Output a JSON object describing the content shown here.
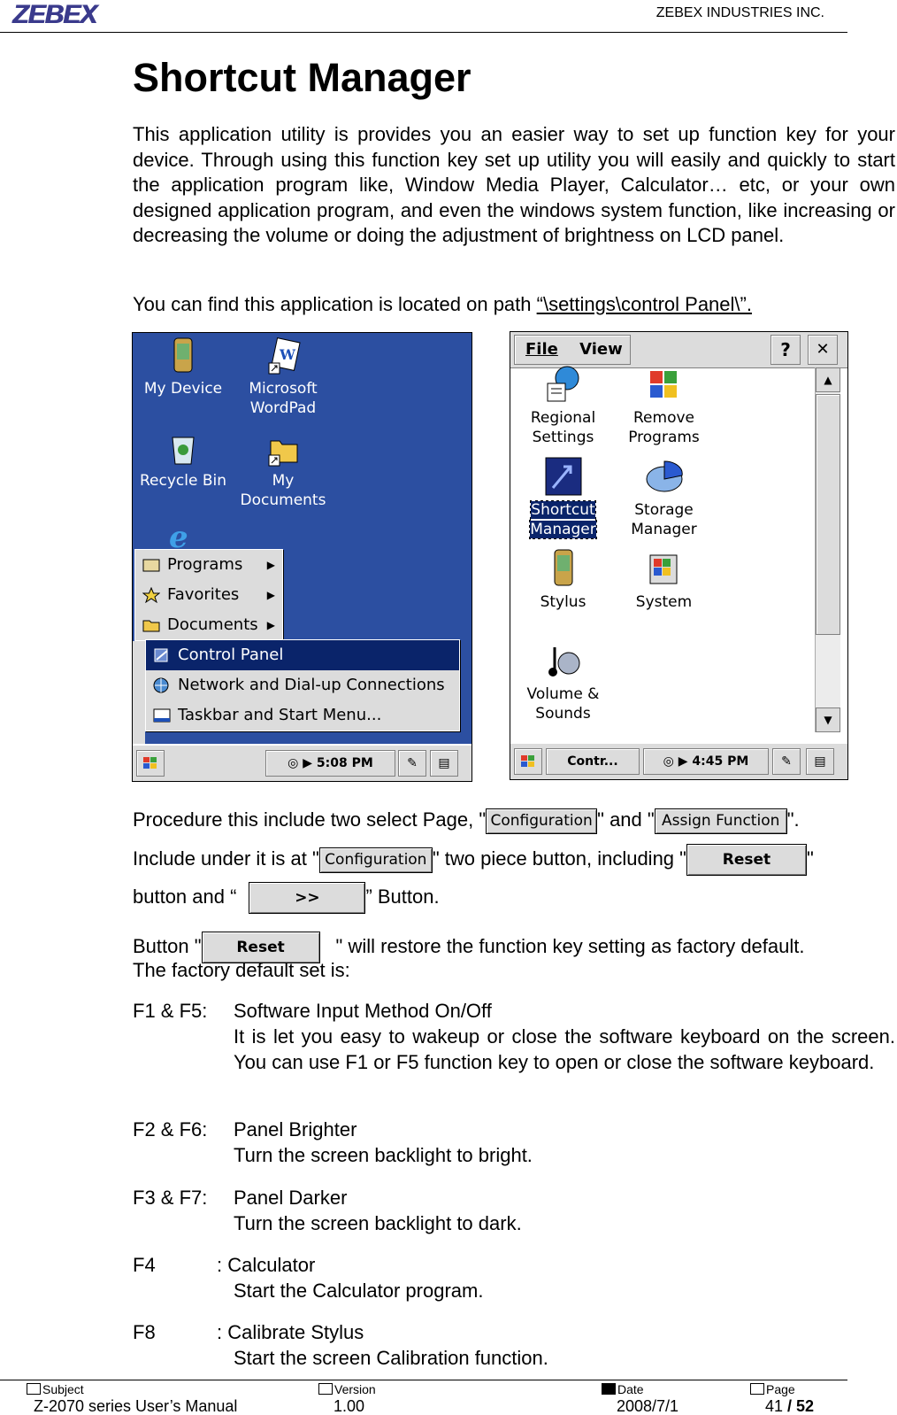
{
  "header": {
    "logo": "ZEBEX",
    "company": "ZEBEX INDUSTRIES INC."
  },
  "title": "Shortcut Manager",
  "intro": "This application utility is provides you an easier way to set up function key for your device. Through using this function key set up utility you will easily and quickly to start the application program like, Window Media Player, Calculator… etc, or your own designed application program, and even the windows system function, like increasing or decreasing the volume or doing the adjustment of brightness on LCD panel.",
  "path_line": {
    "text": "You can find this application is located on path ",
    "path": "“\\settings\\control Panel\\”."
  },
  "screen1": {
    "icons": [
      {
        "label": "My Device"
      },
      {
        "label": "Microsoft WordPad"
      },
      {
        "label": "Recycle Bin"
      },
      {
        "label": "My Documents"
      }
    ],
    "menu_top": [
      "Programs",
      "Favorites",
      "Documents"
    ],
    "menu_sub": [
      "Control Panel",
      "Network and Dial-up Connections",
      "Taskbar and Start Menu..."
    ],
    "time": "5:08 PM"
  },
  "screen2": {
    "menu": [
      "File",
      "View"
    ],
    "help": "?",
    "close": "✕",
    "icons": [
      {
        "label": "Regional Settings"
      },
      {
        "label": "Remove Programs"
      },
      {
        "label": "Shortcut Manager"
      },
      {
        "label": "Storage Manager"
      },
      {
        "label": "Stylus"
      },
      {
        "label": "System"
      },
      {
        "label": "Volume & Sounds"
      }
    ],
    "task": "Contr...",
    "time": "4:45 PM"
  },
  "procedure": {
    "l1a": "Procedure this include two select Page, \"",
    "l1b": "\" and \"",
    "l1c": "\".",
    "l2a": "Include under it is at \"",
    "l2b": "\" two piece button, including \"",
    "l2c": "\"",
    "l3a": "button and “",
    "l3b": "” Button.",
    "btn_config": "Configuration",
    "btn_assign": "Assign Function",
    "btn_reset": "Reset",
    "btn_next": ">>"
  },
  "reset_line": {
    "a": "Button \"",
    "b": "\" will restore the function key setting as factory default.",
    "c": "The factory default set is:"
  },
  "functions": [
    {
      "key": "F1 & F5:",
      "name": "Software Input Method On/Off",
      "desc": "It is let you easy to wakeup or close the software keyboard on the screen. You can use F1 or F5 function key to open or close the software keyboard."
    },
    {
      "key": "F2 & F6:",
      "name": "Panel Brighter",
      "desc": "Turn the screen backlight to bright."
    },
    {
      "key": "F3 & F7:",
      "name": "Panel Darker",
      "desc": "Turn the screen backlight to dark."
    },
    {
      "key": "F4",
      "name": ": Calculator",
      "desc": "Start the Calculator program."
    },
    {
      "key": "F8",
      "name": ": Calibrate Stylus",
      "desc": "Start the screen Calibration function."
    }
  ],
  "footer": {
    "subject_label": "Subject",
    "subject": "Z-2070 series User’s Manual",
    "version_label": "Version",
    "version": "1.00",
    "date_label": "Date",
    "date": "2008/7/1",
    "page_label": "Page",
    "page": "41",
    "page_sep": " / ",
    "total": "52"
  }
}
